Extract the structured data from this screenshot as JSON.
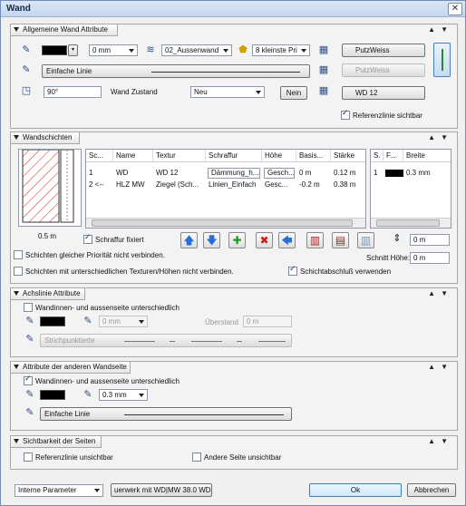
{
  "window": {
    "title": "Wand",
    "close_label": "✕"
  },
  "panels": {
    "allgemein": {
      "title": "Allgemeine Wand Attribute",
      "pen_thickness": "0 mm",
      "layer": "02_Aussenwand",
      "priority": "8 kleinste Pri",
      "surface_1": "PutzWeiss",
      "surface_2": "PutzWeiss",
      "line_type": "Einfache Linie",
      "angle": "90°",
      "zustand_label": "Wand Zustand",
      "zustand_value": "Neu",
      "nein_label": "Nein",
      "texture": "WD 12",
      "referenzlinie_label": "Referenzlinie sichtbar"
    },
    "wandschichten": {
      "title": "Wandschichten",
      "preview_width": "0.5 m",
      "columns": [
        "Sc...",
        "Name",
        "Textur",
        "Schraffur",
        "Höhe",
        "Basis...",
        "Stärke"
      ],
      "rows": [
        [
          "1",
          "WD",
          "WD 12",
          "Dämmung_h...",
          "Gesch...",
          "0 m",
          "0.12 m"
        ],
        [
          "2 <--",
          "HLZ MW",
          "Ziegel (Sch...",
          "Linien_Einfach",
          "Gesc...",
          "-0.2 m",
          "0.38 m"
        ]
      ],
      "right_columns": [
        "S.",
        "F...",
        "Breite"
      ],
      "right_rows": [
        [
          "1",
          "",
          "0.3 mm"
        ]
      ],
      "schraffur_fixiert": "Schraffur fixiert",
      "height_value": "0 m",
      "schnitt_hoehe_label": "Schnitt Höhe:",
      "schnitt_hoehe_value": "0 m",
      "opt_prioritaet": "Schichten gleicher Priorität nicht verbinden.",
      "opt_texturen": "Schichten mit unterschiedlichen Texturen/Höhen nicht verbinden.",
      "opt_schichtabschluss": "Schichtabschluß verwenden"
    },
    "achslinie": {
      "title": "Achslinie Attribute",
      "unterschiedlich": "Wandinnen- und aussenseite unterschiedlich",
      "pen_thickness": "0 mm",
      "ueberstand_label": "Überstand",
      "ueberstand_value": "0 m",
      "line_type": "Strichpunktierte"
    },
    "andere_seite": {
      "title": "Attribute der anderen Wandseite",
      "unterschiedlich": "Wandinnen- und aussenseite unterschiedlich",
      "pen_thickness": "0.3 mm",
      "line_type": "Einfache Linie"
    },
    "sichtbarkeit": {
      "title": "Sichtbarkeit der Seiten",
      "referenz_unsichtbar": "Referenzlinie unsichtbar",
      "andere_unsichtbar": "Andere Seite unsichtbar"
    }
  },
  "footer": {
    "params": "Interne Parameter",
    "wall_name": "uerwerk mit WD|MW 38.0 WD",
    "ok": "Ok",
    "cancel": "Abbrechen"
  }
}
